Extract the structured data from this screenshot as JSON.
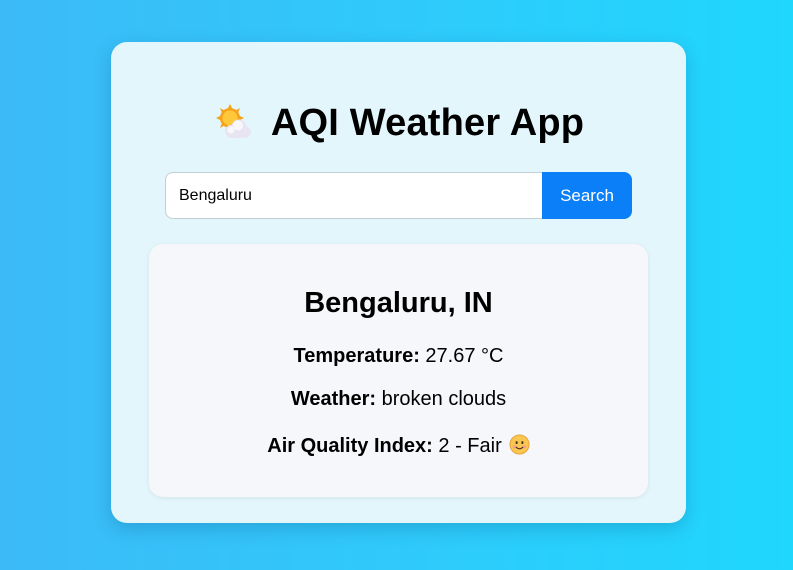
{
  "app": {
    "title": "AQI Weather App",
    "title_icon": "sun-behind-cloud-icon"
  },
  "search": {
    "value": "Bengaluru",
    "button_label": "Search"
  },
  "result": {
    "city": "Bengaluru, IN",
    "temperature_label": "Temperature:",
    "temperature_value": "27.67 °C",
    "weather_label": "Weather:",
    "weather_value": "broken clouds",
    "aqi_label": "Air Quality Index:",
    "aqi_value": "2 - Fair",
    "aqi_icon": "slightly-smiling-face-icon"
  },
  "colors": {
    "background_start": "#3cbaf7",
    "background_end": "#1fd7fd",
    "card": "#e2f6fc",
    "panel": "#f5f7fa",
    "button": "#0a7ff7"
  }
}
